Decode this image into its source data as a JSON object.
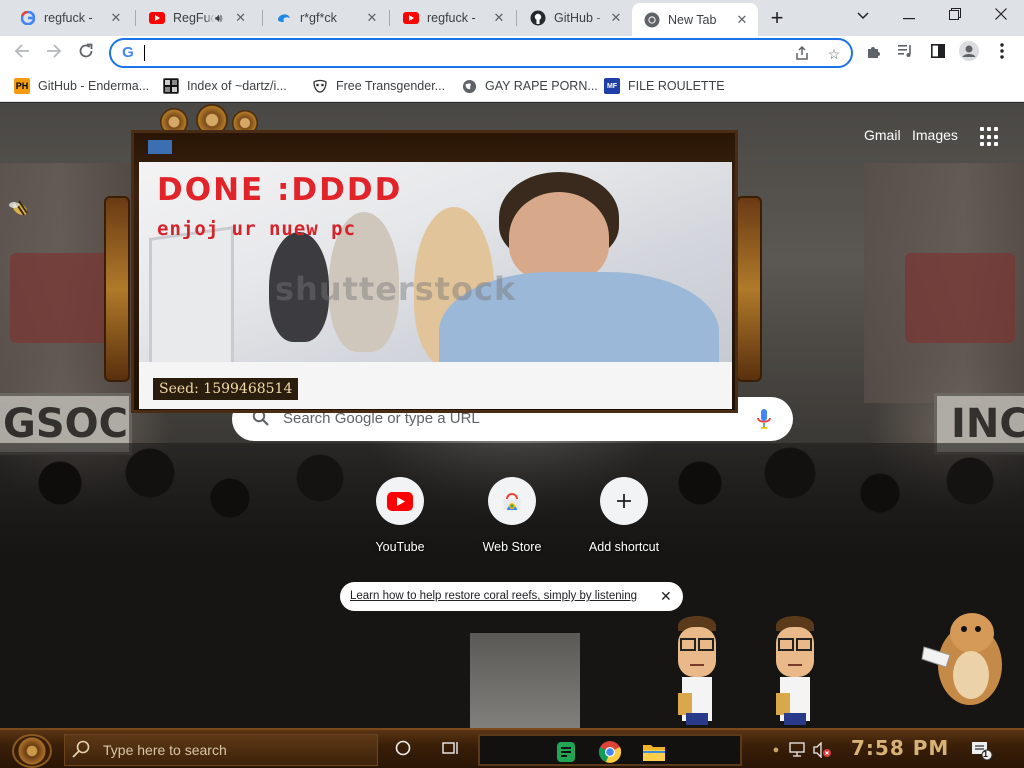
{
  "browser": {
    "tabs": [
      {
        "title": "regfuck - ",
        "icon": "google-icon"
      },
      {
        "title": "RegFuck",
        "icon": "youtube-icon"
      },
      {
        "title": "r*gf*ck",
        "icon": "edge-swirl-icon"
      },
      {
        "title": "regfuck - ",
        "icon": "youtube-icon"
      },
      {
        "title": "GitHub - ",
        "icon": "github-icon"
      },
      {
        "title": "New Tab",
        "icon": "chrome-icon"
      }
    ],
    "new_tab_symbol": "+",
    "omnibox": {
      "value": "",
      "placeholder": ""
    },
    "bookmarks": [
      {
        "label": "GitHub - Enderma...",
        "icon": "ph-icon"
      },
      {
        "label": "Index of ~dartz/i...",
        "icon": "index-icon"
      },
      {
        "label": "Free Transgender...",
        "icon": "mask-icon"
      },
      {
        "label": "GAY RAPE PORN...",
        "icon": "globe-icon"
      },
      {
        "label": "FILE ROULETTE",
        "icon": "mft-icon"
      }
    ],
    "bookmark_icon_text": {
      "ph": "PH",
      "mft": "MF"
    }
  },
  "ntp": {
    "gmail_label": "Gmail",
    "images_label": "Images",
    "search_placeholder": "Search Google or type a URL",
    "shortcuts": [
      {
        "label": "YouTube",
        "icon": "youtube-icon"
      },
      {
        "label": "Web Store",
        "icon": "chrome-web-store-icon"
      },
      {
        "label": "Add shortcut",
        "icon": "plus-icon"
      }
    ],
    "promo_text": "Learn how to help restore coral reefs, simply by listening",
    "background_signs": {
      "left": "GSOC",
      "right": "INC"
    }
  },
  "popup": {
    "headline": "DONE :DDDD",
    "subline": "enjoj ur nuew pc",
    "watermark": "shutterstock",
    "seed_text": "Seed: 1599468514"
  },
  "taskbar": {
    "search_placeholder": "Type here to search",
    "time": "7:58 PM",
    "notification_count": "1"
  },
  "colors": {
    "accent": "#1a73e8",
    "youtube_red": "#ff0000",
    "popup_text_red": "#e0242a",
    "clock_gold": "#d7b276"
  }
}
